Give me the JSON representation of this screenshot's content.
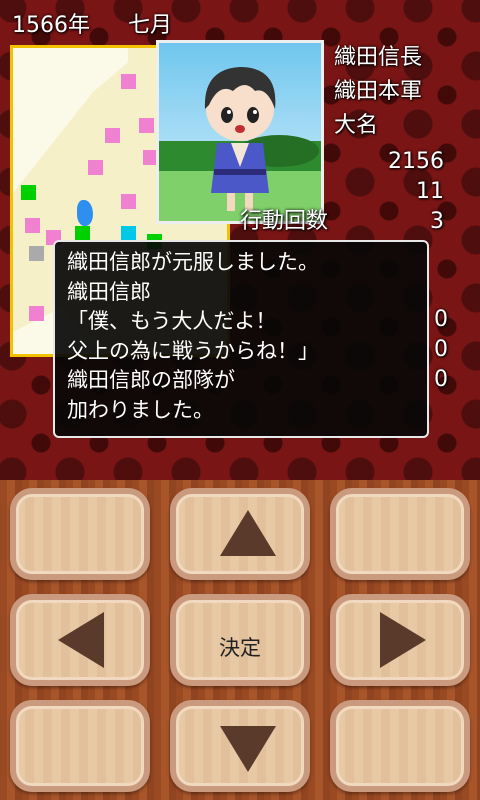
{
  "header": {
    "year": "1566年",
    "month": "七月"
  },
  "daimyo": {
    "name": "織田信長",
    "army": "織田本軍",
    "rank": "大名",
    "stats": [
      "2156",
      "11",
      "3",
      "0",
      "0",
      "0"
    ]
  },
  "hidden_labels": {
    "actions": "行動回数"
  },
  "dialog": {
    "lines": [
      "織田信郎が元服しました。",
      "織田信郎",
      "「僕、もう大人だよ！",
      "父上の為に戦うからね！」",
      "織田信郎の部隊が",
      "加わりました。"
    ]
  },
  "controls": {
    "confirm_label": "決定"
  },
  "colors": {
    "accent_gold": "#f2c200",
    "province_pink": "#f080d0",
    "province_green": "#00d000",
    "province_cyan": "#00c8e8"
  },
  "icons": [
    "up-arrow-icon",
    "left-arrow-icon",
    "right-arrow-icon",
    "down-arrow-icon"
  ]
}
